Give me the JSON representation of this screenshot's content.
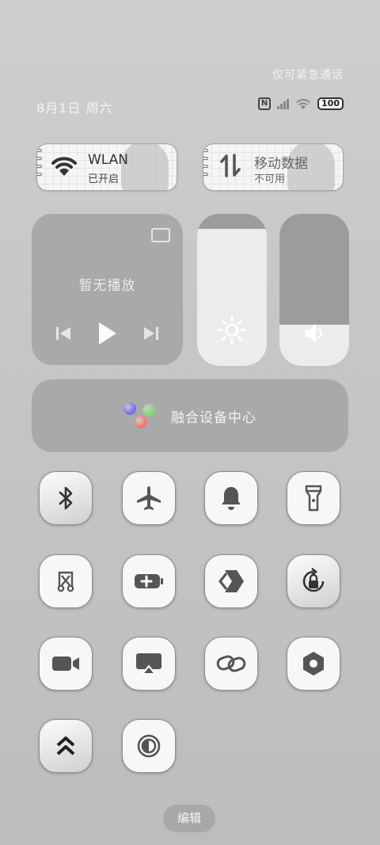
{
  "status": {
    "emergency_text": "仅可紧急通话",
    "date": "8月1日 周六",
    "nfc_label": "N",
    "battery": "100"
  },
  "cards": {
    "wlan": {
      "title": "WLAN",
      "subtitle": "已开启",
      "icon": "wifi-icon"
    },
    "mobile_data": {
      "title": "移动数据",
      "subtitle": "不可用",
      "icon": "data-arrows-icon"
    }
  },
  "media": {
    "empty_text": "暂无播放",
    "icons": [
      "cast-icon",
      "previous-icon",
      "play-icon",
      "next-icon"
    ]
  },
  "sliders": {
    "brightness": {
      "icon": "sun-icon",
      "level": 0.9
    },
    "volume": {
      "icon": "speaker-icon",
      "level": 0.27
    }
  },
  "fusion": {
    "label": "融合设备中心",
    "dot_colors": [
      "#7c6cf2",
      "#7fd97a",
      "#f5766b"
    ]
  },
  "toggles": [
    "bluetooth-icon",
    "airplane-icon",
    "bell-icon",
    "flashlight-icon",
    "screenshot-icon",
    "battery-saver-icon",
    "share-icon",
    "rotation-lock-icon",
    "screen-record-icon",
    "screen-cast-icon",
    "link-icon",
    "settings-icon",
    "chevron-up-icon",
    "contrast-icon"
  ],
  "edit_label": "编辑"
}
